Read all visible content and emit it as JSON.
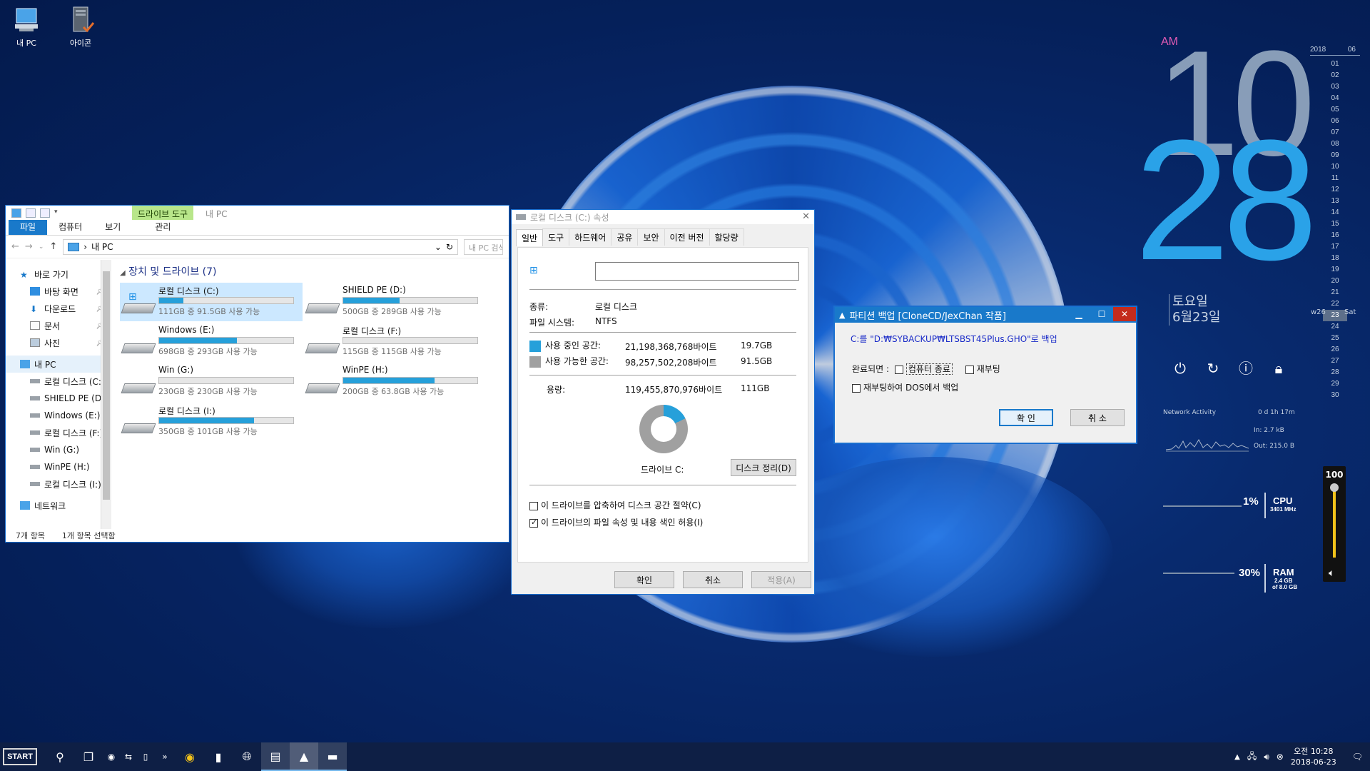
{
  "desktop": {
    "icons": [
      {
        "label": "내 PC",
        "icon": "computer-icon"
      },
      {
        "label": "아이콘",
        "icon": "server-icon"
      }
    ]
  },
  "clock": {
    "ampm": "AM",
    "hour": "10",
    "minute": "28",
    "weekday": "토요일",
    "date": "6월23일"
  },
  "calendar": {
    "year": "2018",
    "month": "06",
    "days": [
      "01",
      "02",
      "03",
      "04",
      "05",
      "06",
      "07",
      "08",
      "09",
      "10",
      "11",
      "12",
      "13",
      "14",
      "15",
      "16",
      "17",
      "18",
      "19",
      "20",
      "21",
      "22",
      "23",
      "24",
      "25",
      "26",
      "27",
      "28",
      "29",
      "30"
    ],
    "today": "23",
    "week": "w26",
    "weekday_short": "Sat"
  },
  "network": {
    "title": "Network Activity",
    "uptime": "0 d 1h 17m",
    "in": "In: 2.7 kB",
    "out": "Out: 215.0 B"
  },
  "meters": {
    "cpu": {
      "pct": "1%",
      "label": "CPU",
      "sub": "3401 MHz"
    },
    "ram": {
      "pct": "30%",
      "label": "RAM",
      "sub1": "2.4 GB",
      "sub2": "of 8.0 GB"
    }
  },
  "volume": {
    "value": "100",
    "level": 1.0
  },
  "explorer": {
    "context_tab": "드라이브 도구",
    "title": "내 PC",
    "ribbon_tabs": [
      "파일",
      "컴퓨터",
      "보기",
      "관리"
    ],
    "address": "내 PC",
    "search_placeholder": "내 PC 검색",
    "nav": [
      {
        "label": "바로 가기",
        "icon": "star-icon"
      },
      {
        "label": "바탕 화면",
        "icon": "desktop-icon"
      },
      {
        "label": "다운로드",
        "icon": "download-icon"
      },
      {
        "label": "문서",
        "icon": "document-icon"
      },
      {
        "label": "사진",
        "icon": "picture-icon"
      },
      {
        "label": "내 PC",
        "icon": "computer-icon"
      },
      {
        "label": "로컬 디스크 (C:)",
        "icon": "drive-icon"
      },
      {
        "label": "SHIELD PE (D:)",
        "icon": "drive-icon"
      },
      {
        "label": "Windows (E:)",
        "icon": "drive-icon"
      },
      {
        "label": "로컬 디스크 (F:)",
        "icon": "drive-icon"
      },
      {
        "label": "Win (G:)",
        "icon": "drive-icon"
      },
      {
        "label": "WinPE (H:)",
        "icon": "drive-icon"
      },
      {
        "label": "로컬 디스크 (I:)",
        "icon": "drive-icon"
      },
      {
        "label": "네트워크",
        "icon": "network-icon"
      }
    ],
    "group_title": "장치 및 드라이브 (7)",
    "drives": [
      {
        "name": "로컬 디스크 (C:)",
        "free": "111GB 중 91.5GB 사용 가능",
        "used_fraction": 0.18,
        "windows": true
      },
      {
        "name": "SHIELD PE (D:)",
        "free": "500GB 중 289GB 사용 가능",
        "used_fraction": 0.42,
        "windows": false
      },
      {
        "name": "Windows (E:)",
        "free": "698GB 중 293GB 사용 가능",
        "used_fraction": 0.58,
        "windows": false
      },
      {
        "name": "로컬 디스크 (F:)",
        "free": "115GB 중 115GB 사용 가능",
        "used_fraction": 0.0,
        "windows": false
      },
      {
        "name": "Win (G:)",
        "free": "230GB 중 230GB 사용 가능",
        "used_fraction": 0.0,
        "windows": false
      },
      {
        "name": "WinPE (H:)",
        "free": "200GB 중 63.8GB 사용 가능",
        "used_fraction": 0.68,
        "windows": false
      },
      {
        "name": "로컬 디스크 (I:)",
        "free": "350GB 중 101GB 사용 가능",
        "used_fraction": 0.71,
        "windows": false
      }
    ],
    "status_count": "7개 항목",
    "status_selected": "1개 항목 선택함"
  },
  "properties": {
    "title": "로컬 디스크 (C:) 속성",
    "tabs": [
      "일반",
      "도구",
      "하드웨어",
      "공유",
      "보안",
      "이전 버전",
      "할당량"
    ],
    "type_label": "종류:",
    "type_value": "로컬 디스크",
    "fs_label": "파일 시스템:",
    "fs_value": "NTFS",
    "used_label": "사용 중인 공간:",
    "used_bytes": "21,198,368,768바이트",
    "used_gb": "19.7GB",
    "free_label": "사용 가능한 공간:",
    "free_bytes": "98,257,502,208바이트",
    "free_gb": "91.5GB",
    "capacity_label": "용량:",
    "capacity_bytes": "119,455,870,976바이트",
    "capacity_gb": "111GB",
    "drive_label": "드라이브 C:",
    "cleanup_button": "디스크 정리(D)",
    "compress_label": "이 드라이브를 압축하여 디스크 공간 절약(C)",
    "compress_checked": false,
    "index_label": "이 드라이브의 파일 속성 및 내용 색인 허용(I)",
    "index_checked": true,
    "ok": "확인",
    "cancel": "취소",
    "apply": "적용(A)",
    "used_color": "#26a0da",
    "free_color": "#a0a0a0",
    "used_fraction": 0.177
  },
  "partition_backup": {
    "title": "파티션 백업  [CloneCD/JexChan 작품]",
    "path_text": "C:를 \"D:₩SYBACKUP₩LTSBST45Plus.GHO\"로 백업",
    "done_label": "완료되면 :",
    "shutdown_label": "컴퓨터 종료",
    "reboot_label": "재부팅",
    "dos_label": "재부팅하여 DOS에서 백업",
    "ok": "확 인",
    "cancel": "취 소"
  },
  "taskbar": {
    "start": "START",
    "time": "오전 10:28",
    "date": "2018-06-23"
  }
}
